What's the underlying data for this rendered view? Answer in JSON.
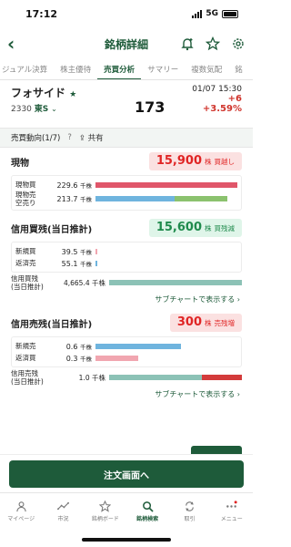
{
  "status_bar": {
    "time": "17:12",
    "network": "5G"
  },
  "nav": {
    "back_glyph": "‹",
    "title": "銘柄詳細"
  },
  "tabs": [
    {
      "label": "ジュアル決算"
    },
    {
      "label": "株主優待"
    },
    {
      "label": "売買分析",
      "active": true
    },
    {
      "label": "サマリー"
    },
    {
      "label": "複数気配"
    },
    {
      "label": "銘"
    }
  ],
  "quote": {
    "name": "フォサイド",
    "code": "2330",
    "market": "東S",
    "datetime": "01/07 15:30",
    "price": "173",
    "change": "+6",
    "change_pct": "+3.59%"
  },
  "section": {
    "title": "売買動向(1/7)",
    "info_label": "?",
    "share_label": "共有"
  },
  "spot": {
    "title": "現物",
    "amount": "15,900",
    "unit": "株",
    "tag": "買越し",
    "rows": [
      {
        "label": "現物買",
        "value": "229.6",
        "unit": "千株",
        "ratio": 1.0
      },
      {
        "label": "現物売\n空売り",
        "value": "213.7",
        "unit": "千株",
        "ratio": 0.93,
        "split": 0.6
      }
    ]
  },
  "margin_buy": {
    "title": "信用買残(当日推計)",
    "amount": "15,600",
    "unit": "株",
    "tag": "買残減",
    "rows": [
      {
        "label": "新規買",
        "value": "39.5",
        "unit": "千株",
        "ratio": 0.01
      },
      {
        "label": "返済売",
        "value": "55.1",
        "unit": "千株",
        "ratio": 0.01
      }
    ],
    "balance": {
      "label": "信用買残\n(当日推計)",
      "value": "4,665.4",
      "unit": "千株",
      "ratio": 1.0
    },
    "subchart_link": "サブチャートで表示する"
  },
  "margin_sell": {
    "title": "信用売残(当日推計)",
    "amount": "300",
    "unit": "株",
    "tag": "売残増",
    "rows": [
      {
        "label": "新規売",
        "value": "0.6",
        "unit": "千株",
        "ratio": 0.6
      },
      {
        "label": "返済買",
        "value": "0.3",
        "unit": "千株",
        "ratio": 0.3
      }
    ],
    "balance": {
      "label": "信用売残\n(当日推計)",
      "value": "1.0",
      "unit": "千株",
      "ratio": 1.0,
      "split": 0.7
    },
    "subchart_link": "サブチャートで表示する"
  },
  "cta": {
    "label": "注文画面へ"
  },
  "tabbar": [
    {
      "label": "マイページ",
      "icon": "person-icon"
    },
    {
      "label": "市況",
      "icon": "market-icon"
    },
    {
      "label": "銘柄ボード",
      "icon": "star-icon"
    },
    {
      "label": "銘柄検索",
      "icon": "search-icon",
      "active": true
    },
    {
      "label": "取引",
      "icon": "trade-icon"
    },
    {
      "label": "メニュー",
      "icon": "menu-icon"
    }
  ],
  "colors": {
    "accent": "#1e5b3a",
    "up": "#e02424",
    "down_green": "#1f8a4c"
  }
}
